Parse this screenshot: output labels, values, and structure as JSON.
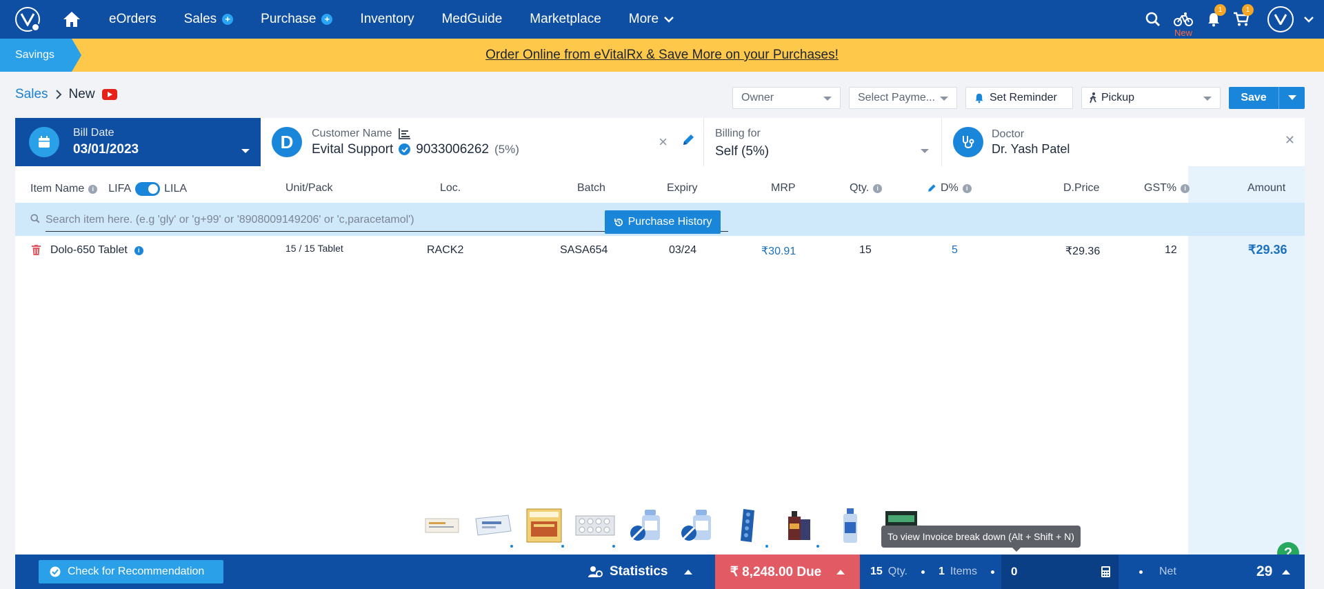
{
  "nav": {
    "items": [
      {
        "label": "eOrders",
        "plus": false
      },
      {
        "label": "Sales",
        "plus": true
      },
      {
        "label": "Purchase",
        "plus": true
      },
      {
        "label": "Inventory",
        "plus": false
      },
      {
        "label": "MedGuide",
        "plus": false
      },
      {
        "label": "Marketplace",
        "plus": false
      },
      {
        "label": "More",
        "plus": false
      }
    ],
    "new_tag": "New",
    "notification_count": "1",
    "cart_count": "1",
    "icons": [
      "home-icon",
      "search-icon",
      "delivery-bike-icon",
      "bell-icon",
      "cart-icon",
      "avatar"
    ]
  },
  "banner": {
    "savings_label": "Savings",
    "link_text": "Order Online from eVitalRx & Save More on your Purchases!"
  },
  "breadcrumb": {
    "root": "Sales",
    "current": "New"
  },
  "toolbar": {
    "owner": "Owner",
    "payment": "Select Payme...",
    "reminder": "Set Reminder",
    "pickup": "Pickup",
    "save": "Save"
  },
  "bill": {
    "label": "Bill Date",
    "value": "03/01/2023"
  },
  "customer": {
    "initial": "D",
    "label": "Customer Name",
    "name": "Evital Support",
    "phone": "9033006262",
    "discount": "(5%)"
  },
  "billing": {
    "label": "Billing for",
    "value": "Self (5%)"
  },
  "doctor": {
    "label": "Doctor",
    "value": "Dr. Yash Patel"
  },
  "table": {
    "headers": {
      "item_name": "Item Name",
      "lifa": "LIFA",
      "lila": "LILA",
      "unit_pack": "Unit/Pack",
      "loc": "Loc.",
      "batch": "Batch",
      "expiry": "Expiry",
      "mrp": "MRP",
      "qty": "Qty.",
      "discount": "D%",
      "dprice": "D.Price",
      "gst": "GST%",
      "amount": "Amount"
    },
    "search_placeholder": "Search item here. (e.g 'gly' or 'g+99' or '8908009149206' or 'c,paracetamol')",
    "purchase_history": "Purchase History",
    "rows": [
      {
        "item": "Dolo-650 Tablet",
        "unit_pack": "15 / 15 Tablet",
        "loc": "RACK2",
        "batch": "SASA654",
        "expiry": "03/24",
        "mrp": "₹30.91",
        "qty": "15",
        "discount": "5",
        "dprice": "₹29.36",
        "gst": "12",
        "amount": "₹29.36"
      }
    ]
  },
  "tooltip": "To view Invoice break down (Alt + Shift + N)",
  "help": "?",
  "footer": {
    "recommendation": "Check for Recommendation",
    "statistics": "Statistics",
    "due_amount": "₹ 8,248.00 Due",
    "qty_value": "15",
    "qty_label": "Qty.",
    "items_value": "1",
    "items_label": "Items",
    "box_value": "0",
    "net_label": "Net",
    "net_value": "29"
  }
}
